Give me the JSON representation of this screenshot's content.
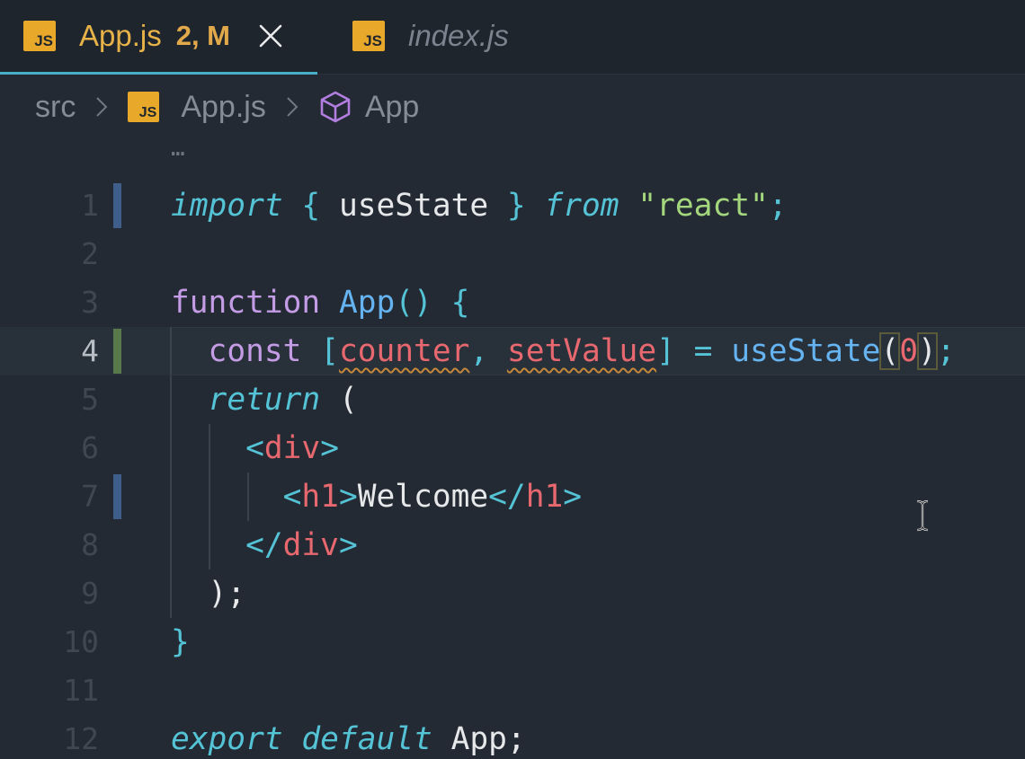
{
  "tabs": [
    {
      "label": "App.js",
      "badge": "2, M",
      "icon": "JS",
      "active": true
    },
    {
      "label": "index.js",
      "icon": "JS",
      "active": false
    }
  ],
  "breadcrumb": {
    "folder": "src",
    "file": "App.js",
    "file_icon": "JS",
    "symbol": "App"
  },
  "editor": {
    "ellipsis": "…",
    "line_numbers": [
      "1",
      "2",
      "3",
      "4",
      "5",
      "6",
      "7",
      "8",
      "9",
      "10",
      "11",
      "12"
    ],
    "line1": {
      "import": "import",
      "lbrace": "{",
      "name": "useState",
      "rbrace": "}",
      "from": "from",
      "module": "\"react\"",
      "semi": ";"
    },
    "line3": {
      "function": "function",
      "name": "App",
      "parens": "()",
      "brace": "{"
    },
    "line4": {
      "const": "const",
      "lbracket": "[",
      "var1": "counter",
      "comma": ",",
      "var2": "setValue",
      "rbracket": "]",
      "eq": "=",
      "call": "useState",
      "lparen": "(",
      "arg": "0",
      "rparen": ")",
      "semi": ";"
    },
    "line5": {
      "return": "return",
      "paren": "("
    },
    "line6": {
      "open": "<",
      "tag": "div",
      "close": ">"
    },
    "line7": {
      "open": "<",
      "tag": "h1",
      "close": ">",
      "text": "Welcome",
      "endopen": "</",
      "endtag": "h1",
      "endclose": ">"
    },
    "line8": {
      "open": "</",
      "tag": "div",
      "close": ">"
    },
    "line9": {
      "text": ");"
    },
    "line10": {
      "text": "}"
    },
    "line12": {
      "export": "export",
      "default": "default",
      "name": "App",
      "semi": ";"
    }
  },
  "colors": {
    "background": "#232a33",
    "tab_active_text": "#e7b349",
    "js_icon": "#e8a92b",
    "keyword": "#55c3d6",
    "storage": "#c49ce6",
    "function": "#65b3f0",
    "string": "#a4d67e",
    "variable": "#e8686f",
    "gutter_modified": "#3f5f8a",
    "gutter_added": "#587a4b"
  },
  "icons": [
    "js-file-icon",
    "close-icon",
    "chevron-right-icon",
    "symbol-class-cube-icon",
    "text-cursor-icon"
  ]
}
